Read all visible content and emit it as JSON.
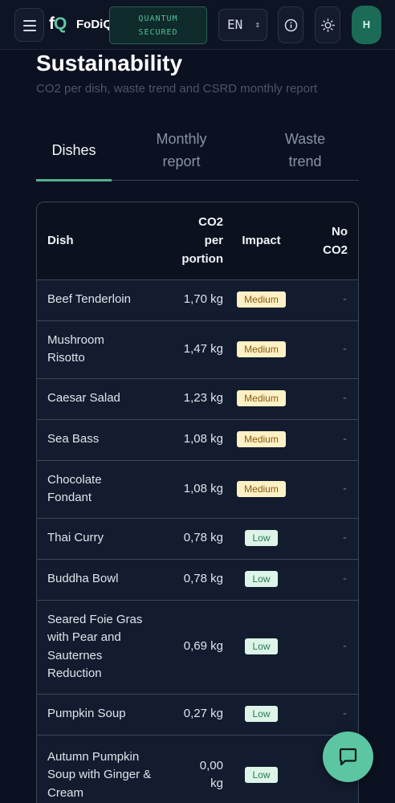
{
  "header": {
    "logo_mark_f": "f",
    "logo_mark_q": "Q",
    "brand": "FoDiQ",
    "quantum_line1": "QUANTUM",
    "quantum_line2": "SECURED",
    "language": "EN",
    "avatar_initial": "H"
  },
  "page": {
    "title": "Sustainability",
    "subtitle": "CO2 per dish, waste trend and CSRD monthly report"
  },
  "tabs": [
    {
      "label": "Dishes",
      "active": true
    },
    {
      "label_line1": "Monthly",
      "label_line2": "report",
      "active": false
    },
    {
      "label_line1": "Waste",
      "label_line2": "trend",
      "active": false
    }
  ],
  "table": {
    "headers": {
      "dish": "Dish",
      "co2_line1": "CO2",
      "co2_line2": "per",
      "co2_line3": "portion",
      "impact": "Impact",
      "noco2_line1": "No",
      "noco2_line2": "CO2"
    },
    "rows": [
      {
        "dish": "Beef Tenderloin",
        "co2": "1,70 kg",
        "impact": "Medium",
        "no_co2": "-"
      },
      {
        "dish": "Mushroom Risotto",
        "co2": "1,47 kg",
        "impact": "Medium",
        "no_co2": "-"
      },
      {
        "dish": "Caesar Salad",
        "co2": "1,23 kg",
        "impact": "Medium",
        "no_co2": "-"
      },
      {
        "dish": "Sea Bass",
        "co2": "1,08 kg",
        "impact": "Medium",
        "no_co2": "-"
      },
      {
        "dish": "Chocolate Fondant",
        "co2": "1,08 kg",
        "impact": "Medium",
        "no_co2": "-"
      },
      {
        "dish": "Thai Curry",
        "co2": "0,78 kg",
        "impact": "Low",
        "no_co2": "-"
      },
      {
        "dish": "Buddha Bowl",
        "co2": "0,78 kg",
        "impact": "Low",
        "no_co2": "-"
      },
      {
        "dish": "Seared Foie Gras with Pear and Sauternes Reduction",
        "co2": "0,69 kg",
        "impact": "Low",
        "no_co2": "-"
      },
      {
        "dish": "Pumpkin Soup",
        "co2": "0,27 kg",
        "impact": "Low",
        "no_co2": "-"
      },
      {
        "dish": "Autumn Pumpkin Soup with Ginger & Cream",
        "co2": "0,00 kg",
        "impact": "Low",
        "no_co2": ""
      }
    ]
  },
  "colors": {
    "accent": "#5cc6a3",
    "medium_badge_bg": "#fdf1c5",
    "low_badge_bg": "#dcf5e8"
  },
  "icons": {
    "menu": "hamburger-icon",
    "info": "info-icon",
    "theme": "sun-icon",
    "language_toggle": "chevron-up-down-icon",
    "chat": "chat-bubble-icon"
  }
}
